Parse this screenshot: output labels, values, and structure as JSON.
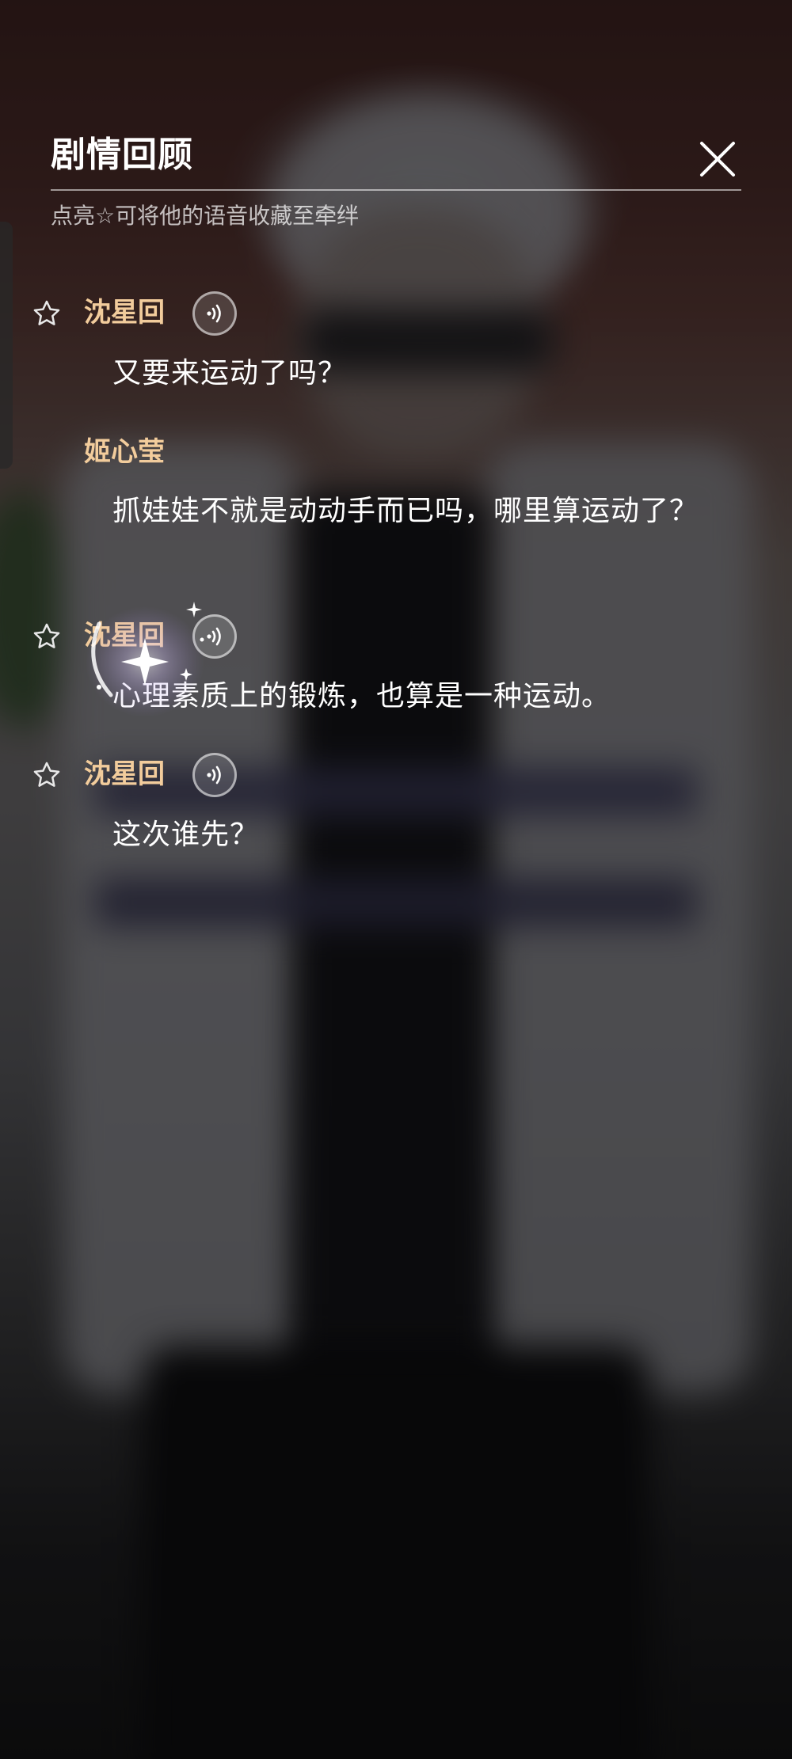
{
  "panel": {
    "title": "剧情回顾",
    "subtitle": "点亮☆可将他的语音收藏至牵绊"
  },
  "dialogue": [
    {
      "speaker": "沈星回",
      "text": "又要来运动了吗？",
      "has_star": true,
      "has_voice": true
    },
    {
      "speaker": "姬心莹",
      "text": "抓娃娃不就是动动手而已吗，哪里算运动了？",
      "has_star": false,
      "has_voice": false
    },
    {
      "speaker": "沈星回",
      "text": "心理素质上的锻炼，也算是一种运动。",
      "has_star": true,
      "has_voice": true
    },
    {
      "speaker": "沈星回",
      "text": "这次谁先？",
      "has_star": true,
      "has_voice": true
    }
  ],
  "colors": {
    "speaker_name": "#f2cc9c",
    "text": "#ffffff",
    "sparkle": "#c9b4f0"
  },
  "icons": {
    "close": "close-icon",
    "star": "star-outline-icon",
    "voice": "voice-wave-icon",
    "sparkle": "sparkle-effect-icon"
  }
}
